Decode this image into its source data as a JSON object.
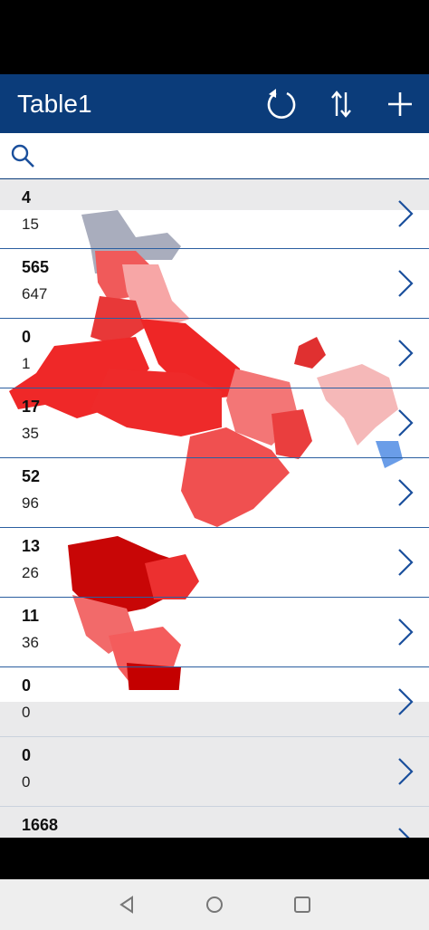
{
  "header": {
    "title": "Table1",
    "icons": [
      "refresh-icon",
      "sort-icon",
      "add-icon"
    ]
  },
  "search": {
    "placeholder": "",
    "icon": "search-icon"
  },
  "rows": [
    {
      "title": "4",
      "subtitle": "15"
    },
    {
      "title": "565",
      "subtitle": "647"
    },
    {
      "title": "0",
      "subtitle": "1"
    },
    {
      "title": "17",
      "subtitle": "35"
    },
    {
      "title": "52",
      "subtitle": "96"
    },
    {
      "title": "13",
      "subtitle": "26"
    },
    {
      "title": "11",
      "subtitle": "36"
    },
    {
      "title": "0",
      "subtitle": "0"
    },
    {
      "title": "0",
      "subtitle": "0"
    },
    {
      "title": "1668",
      "subtitle": ""
    }
  ],
  "colors": {
    "header": "#0b3c7a",
    "accent": "#1a4f9c",
    "map_dark": "#c80000",
    "map_mid": "#ef2a2a",
    "map_light": "#f7a0a0"
  }
}
